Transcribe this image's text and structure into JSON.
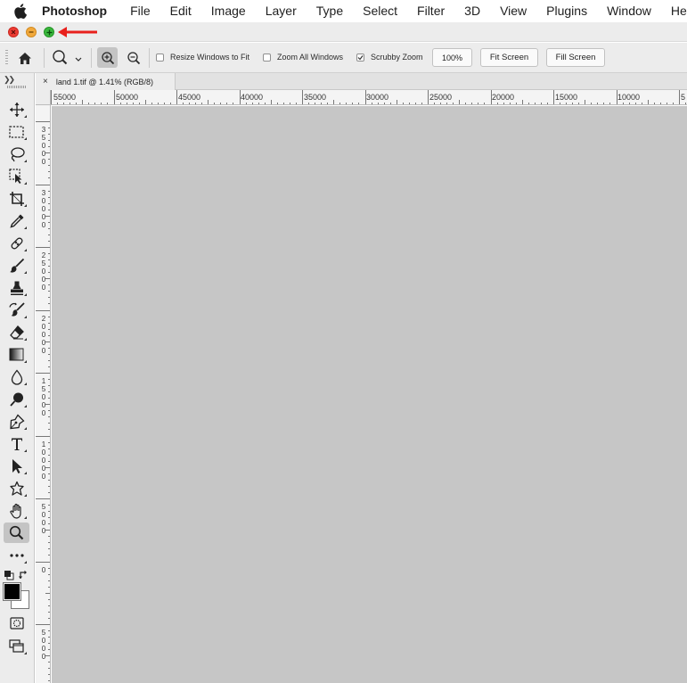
{
  "menubar": {
    "app_name": "Photoshop",
    "items": [
      "File",
      "Edit",
      "Image",
      "Layer",
      "Type",
      "Select",
      "Filter",
      "3D",
      "View",
      "Plugins",
      "Window",
      "Help"
    ]
  },
  "window_controls": {
    "close": "close-button",
    "minimize": "minimize-button",
    "maximize": "zoom-button",
    "annotation_arrow_color": "#e8201c"
  },
  "options_bar": {
    "resize_windows_label": "Resize Windows to Fit",
    "resize_windows_checked": false,
    "zoom_all_label": "Zoom All Windows",
    "zoom_all_checked": false,
    "scrubby_zoom_label": "Scrubby Zoom",
    "scrubby_zoom_checked": true,
    "zoom_percent": "100%",
    "fit_screen_label": "Fit Screen",
    "fill_screen_label": "Fill Screen"
  },
  "document": {
    "tab_title": "land 1.tif @ 1.41% (RGB/8)",
    "tab_close": "×"
  },
  "rulers": {
    "horizontal": [
      "55000",
      "50000",
      "45000",
      "40000",
      "35000",
      "30000",
      "25000",
      "20000",
      "15000",
      "10000",
      "5"
    ],
    "vertical": [
      "35000",
      "30000",
      "25000",
      "20000",
      "15000",
      "10000",
      "5000",
      "0",
      "5000"
    ]
  },
  "tools": [
    "move",
    "rectangular-marquee",
    "lasso",
    "object-selection",
    "crop",
    "eyedropper",
    "spot-healing",
    "brush",
    "clone-stamp",
    "history-brush",
    "eraser",
    "gradient",
    "blur",
    "dodge",
    "pen",
    "type",
    "path-selection",
    "custom-shape",
    "hand",
    "zoom",
    "more-tools"
  ],
  "active_tool": "zoom",
  "colors": {
    "foreground": "#000000",
    "background": "#ffffff",
    "canvas": "#c6c6c6"
  }
}
